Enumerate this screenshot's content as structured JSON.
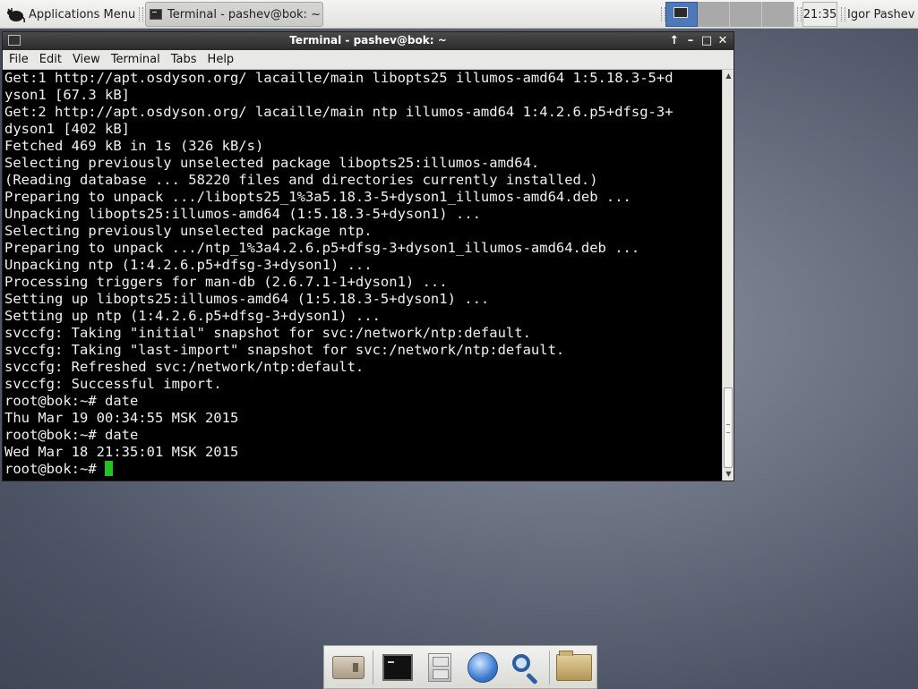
{
  "top_panel": {
    "applications_menu": "Applications Menu",
    "task_button": "Terminal - pashev@bok: ~",
    "clock": "21:35",
    "user": "Igor Pashev",
    "workspace_count": 4
  },
  "window": {
    "title": "Terminal - pashev@bok: ~",
    "controls": {
      "up": "↑",
      "minimize": "–",
      "maximize": "□",
      "close": "✕"
    }
  },
  "menubar": [
    "File",
    "Edit",
    "View",
    "Terminal",
    "Tabs",
    "Help"
  ],
  "terminal": {
    "lines": [
      "Get:1 http://apt.osdyson.org/ lacaille/main libopts25 illumos-amd64 1:5.18.3-5+d",
      "yson1 [67.3 kB]",
      "Get:2 http://apt.osdyson.org/ lacaille/main ntp illumos-amd64 1:4.2.6.p5+dfsg-3+",
      "dyson1 [402 kB]",
      "Fetched 469 kB in 1s (326 kB/s)",
      "Selecting previously unselected package libopts25:illumos-amd64.",
      "(Reading database ... 58220 files and directories currently installed.)",
      "Preparing to unpack .../libopts25_1%3a5.18.3-5+dyson1_illumos-amd64.deb ...",
      "Unpacking libopts25:illumos-amd64 (1:5.18.3-5+dyson1) ...",
      "Selecting previously unselected package ntp.",
      "Preparing to unpack .../ntp_1%3a4.2.6.p5+dfsg-3+dyson1_illumos-amd64.deb ...",
      "Unpacking ntp (1:4.2.6.p5+dfsg-3+dyson1) ...",
      "Processing triggers for man-db (2.6.7.1-1+dyson1) ...",
      "Setting up libopts25:illumos-amd64 (1:5.18.3-5+dyson1) ...",
      "Setting up ntp (1:4.2.6.p5+dfsg-3+dyson1) ...",
      "svccfg: Taking \"initial\" snapshot for svc:/network/ntp:default.",
      "svccfg: Taking \"last-import\" snapshot for svc:/network/ntp:default.",
      "svccfg: Refreshed svc:/network/ntp:default.",
      "svccfg: Successful import.",
      "root@bok:~# date",
      "Thu Mar 19 00:34:55 MSK 2015",
      "root@bok:~# date",
      "Wed Mar 18 21:35:01 MSK 2015"
    ],
    "prompt": "root@bok:~# ",
    "cursor_color": "#22c322"
  },
  "dock": {
    "items": [
      "drive-icon",
      "terminal-icon",
      "file-cabinet-icon",
      "web-browser-icon",
      "search-icon",
      "folder-icon"
    ]
  },
  "colors": {
    "terminal_bg": "#000000",
    "terminal_fg": "#f0f0f0",
    "active_workspace": "#4e79b8"
  }
}
